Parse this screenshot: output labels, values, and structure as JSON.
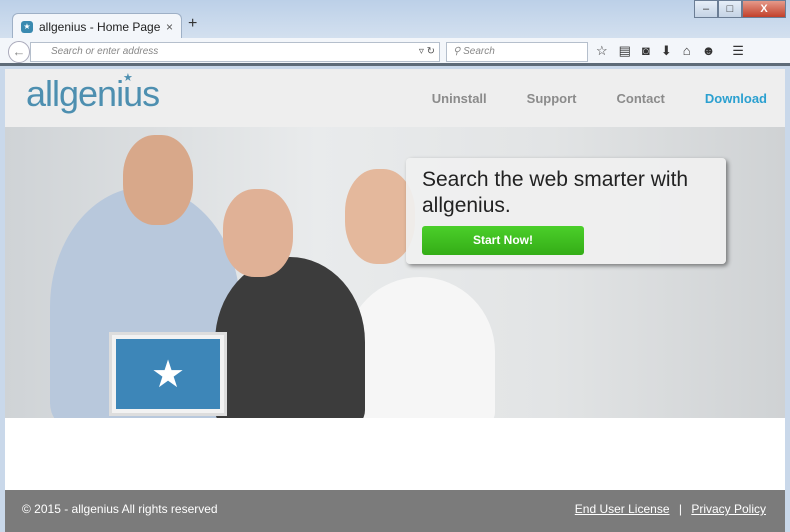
{
  "browser": {
    "tab_title": "allgenius - Home Page",
    "url_placeholder": "Search or enter address",
    "search_placeholder": "Search",
    "window_controls": {
      "minimize": "–",
      "maximize": "□",
      "close": "X"
    }
  },
  "site": {
    "logo": "allgenius",
    "nav": [
      "Uninstall",
      "Support",
      "Contact",
      "Download"
    ],
    "hero": {
      "headline": "Search the web smarter with allgenius.",
      "cta": "Start Now!"
    },
    "footer": {
      "copyright": "© 2015 - allgenius All rights reserved",
      "links": [
        "End User License",
        "Privacy Policy"
      ],
      "separator": "|"
    }
  },
  "colors": {
    "accent": "#2ba0d0",
    "logo": "#4d8fb0",
    "cta": "#3cbf1f",
    "footer": "#7b7b7b"
  }
}
